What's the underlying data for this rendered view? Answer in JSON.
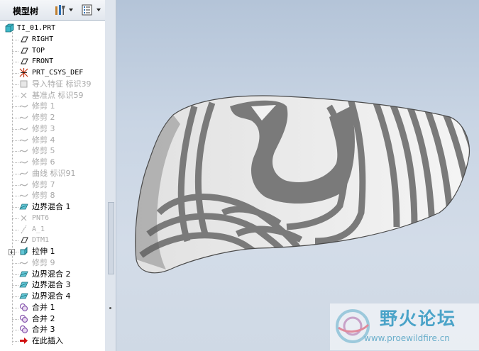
{
  "panel": {
    "title": "模型树",
    "tools_icon": "model-tree-settings-icon",
    "show_icon": "model-tree-show-icon"
  },
  "tree": {
    "root": "TI_01.PRT",
    "items": [
      {
        "label": "RIGHT",
        "icon": "datum-plane-icon",
        "state": "active",
        "mono": true
      },
      {
        "label": "TOP",
        "icon": "datum-plane-icon",
        "state": "active",
        "mono": true
      },
      {
        "label": "FRONT",
        "icon": "datum-plane-icon",
        "state": "active",
        "mono": true
      },
      {
        "label": "PRT_CSYS_DEF",
        "icon": "coordinate-system-icon",
        "state": "active",
        "mono": true
      },
      {
        "label": "导入特征 标识39",
        "icon": "import-feature-icon",
        "state": "dim",
        "mono": false
      },
      {
        "label": "基准点 标识59",
        "icon": "datum-point-icon",
        "state": "dim",
        "mono": false
      },
      {
        "label": "修剪 1",
        "icon": "trim-icon",
        "state": "dim",
        "mono": false
      },
      {
        "label": "修剪 2",
        "icon": "trim-icon",
        "state": "dim",
        "mono": false
      },
      {
        "label": "修剪 3",
        "icon": "trim-icon",
        "state": "dim",
        "mono": false
      },
      {
        "label": "修剪 4",
        "icon": "trim-icon",
        "state": "dim",
        "mono": false
      },
      {
        "label": "修剪 5",
        "icon": "trim-icon",
        "state": "dim",
        "mono": false
      },
      {
        "label": "修剪 6",
        "icon": "trim-icon",
        "state": "dim",
        "mono": false
      },
      {
        "label": "曲线 标识91",
        "icon": "curve-icon",
        "state": "dim",
        "mono": false
      },
      {
        "label": "修剪 7",
        "icon": "trim-icon",
        "state": "dim",
        "mono": false
      },
      {
        "label": "修剪 8",
        "icon": "trim-icon",
        "state": "dim",
        "mono": false
      },
      {
        "label": "边界混合 1",
        "icon": "boundary-blend-icon",
        "state": "active",
        "mono": false
      },
      {
        "label": "PNT6",
        "icon": "datum-point-icon",
        "state": "dim",
        "mono": true
      },
      {
        "label": "A_1",
        "icon": "datum-axis-icon",
        "state": "dim",
        "mono": true
      },
      {
        "label": "DTM1",
        "icon": "datum-plane-icon",
        "state": "dim",
        "mono": true
      },
      {
        "label": "拉伸 1",
        "icon": "extrude-icon",
        "state": "active",
        "mono": false,
        "expandable": true
      },
      {
        "label": "修剪 9",
        "icon": "trim-icon",
        "state": "dim",
        "mono": false
      },
      {
        "label": "边界混合 2",
        "icon": "boundary-blend-icon",
        "state": "active",
        "mono": false
      },
      {
        "label": "边界混合 3",
        "icon": "boundary-blend-icon",
        "state": "active",
        "mono": false
      },
      {
        "label": "边界混合 4",
        "icon": "boundary-blend-icon",
        "state": "active",
        "mono": false
      },
      {
        "label": "合并 1",
        "icon": "merge-icon",
        "state": "active",
        "mono": false
      },
      {
        "label": "合并 2",
        "icon": "merge-icon",
        "state": "active",
        "mono": false
      },
      {
        "label": "合并 3",
        "icon": "merge-icon",
        "state": "active",
        "mono": false
      },
      {
        "label": "在此插入",
        "icon": "insert-here-arrow-icon",
        "state": "active",
        "mono": false
      }
    ]
  },
  "watermark": {
    "text": "野火论坛",
    "url": "www.proewildfire.cn"
  },
  "colors": {
    "background": "#c9d5e4",
    "stripe_light": "#f2f2f2",
    "stripe_dark": "#7a7a7a",
    "watermark": "#4aa3c8"
  }
}
